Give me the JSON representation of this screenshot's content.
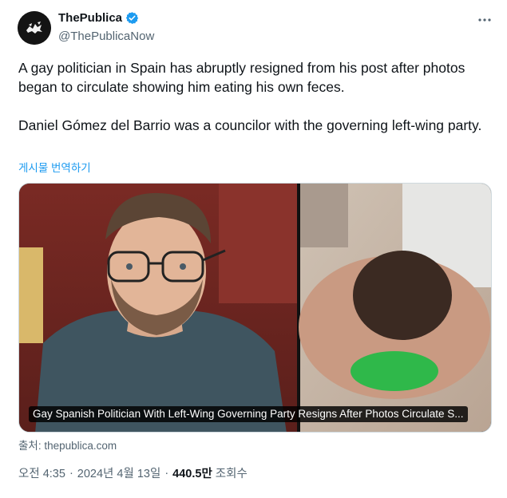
{
  "author": {
    "display_name": "ThePublica",
    "handle": "@ThePublicaNow",
    "verified": true
  },
  "tweet": {
    "paragraphs": [
      "A gay politician in Spain has abruptly resigned from his post after photos began to circulate showing him eating his own feces.",
      "Daniel Gómez del Barrio was a councilor with the governing left-wing party."
    ],
    "translate_label": "게시물 번역하기"
  },
  "media": {
    "caption": "Gay Spanish Politician With Left-Wing Governing Party Resigns After Photos Circulate S..."
  },
  "source_label": "출처: thepublica.com",
  "meta": {
    "time": "오전 4:35",
    "date": "2024년 4월 13일",
    "views_count": "440.5만",
    "views_label": "조회수"
  },
  "icons": {
    "more": "more-horizontal-icon",
    "verified": "verified-badge-icon"
  },
  "colors": {
    "accent": "#1d9bf0",
    "secondary_text": "#536471",
    "primary_text": "#0f1419"
  }
}
